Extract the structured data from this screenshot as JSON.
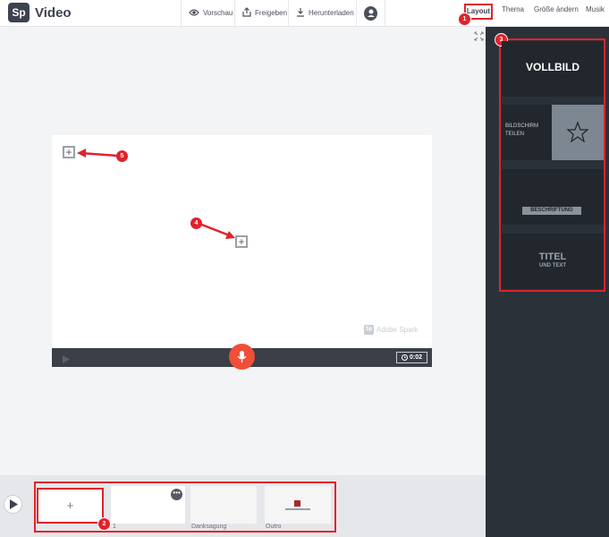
{
  "app": {
    "logo": "Sp",
    "name": "Video"
  },
  "toolbar": {
    "preview": "Vorschau",
    "share": "Freigeben",
    "download": "Herunterladen",
    "account_icon": "person-icon"
  },
  "right_tabs": [
    "Layout",
    "Thema",
    "Größe ändern",
    "Musik"
  ],
  "layouts": {
    "fullscreen": "VOLLBILD",
    "split_line1": "BILDSCHIRM",
    "split_line2": "TEILEN",
    "caption": "BESCHRIFTUNG",
    "title_line1": "TITEL",
    "title_line2": "UND TEXT"
  },
  "canvas": {
    "watermark": "Adobe Spark",
    "time": "0:02"
  },
  "slides": [
    {
      "label": "",
      "type": "add"
    },
    {
      "label": "1",
      "type": "blank"
    },
    {
      "label": "Danksagung",
      "type": "blank"
    },
    {
      "label": "Outro",
      "type": "outro"
    }
  ],
  "annotations": [
    "1",
    "2",
    "3",
    "4",
    "5"
  ],
  "colors": {
    "accent_red": "#e0232c",
    "panel_dark": "#2b3139",
    "mic_button": "#f04e37"
  }
}
